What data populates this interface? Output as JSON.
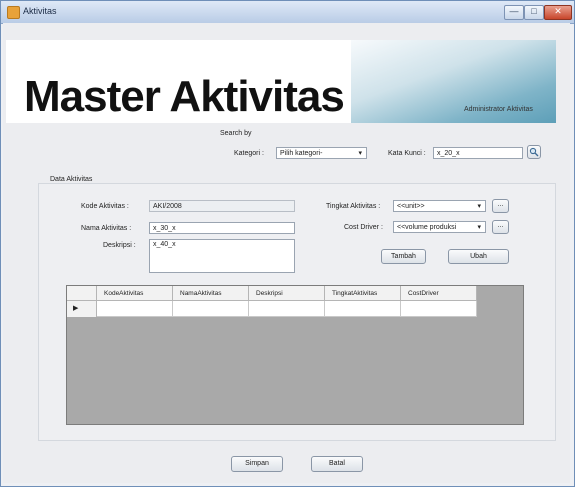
{
  "window": {
    "title": "Aktivitas",
    "minimize_glyph": "—",
    "maximize_glyph": "□",
    "close_glyph": "✕"
  },
  "banner": {
    "title": "Master Aktivitas",
    "admin_text": "Administrator Aktivitas"
  },
  "search": {
    "heading": "Search by",
    "kategori_label": "Kategori :",
    "kategori_value": "Pilih kategori-",
    "kata_kunci_label": "Kata Kunci :",
    "kata_kunci_value": "x_20_x",
    "search_icon": "magnifier-icon"
  },
  "data_aktivitas": {
    "legend": "Data Aktivitas",
    "kode_label": "Kode Aktivitas :",
    "kode_value": "AKI/2008",
    "nama_label": "Nama Aktivitas :",
    "nama_value": "x_30_x",
    "deskripsi_label": "Deskripsi :",
    "deskripsi_value": "x_40_x",
    "tingkat_label": "Tingkat Aktivitas :",
    "tingkat_value": "<<unit>>",
    "cost_driver_label": "Cost Driver :",
    "cost_driver_value": "<<volume produksi",
    "browse_label": "...",
    "tambah_label": "Tambah",
    "ubah_label": "Ubah"
  },
  "grid": {
    "columns": [
      "KodeAktivitas",
      "NamaAktivitas",
      "Deskripsi",
      "TingkatAktivitas",
      "CostDriver"
    ],
    "new_row_marker": "▶"
  },
  "footer": {
    "simpan_label": "Simpan",
    "batal_label": "Batal"
  },
  "colors": {
    "banner_accent": "#5d9fb8",
    "titlebar": "#b9cce6",
    "grid_background": "#a9a9a9"
  }
}
